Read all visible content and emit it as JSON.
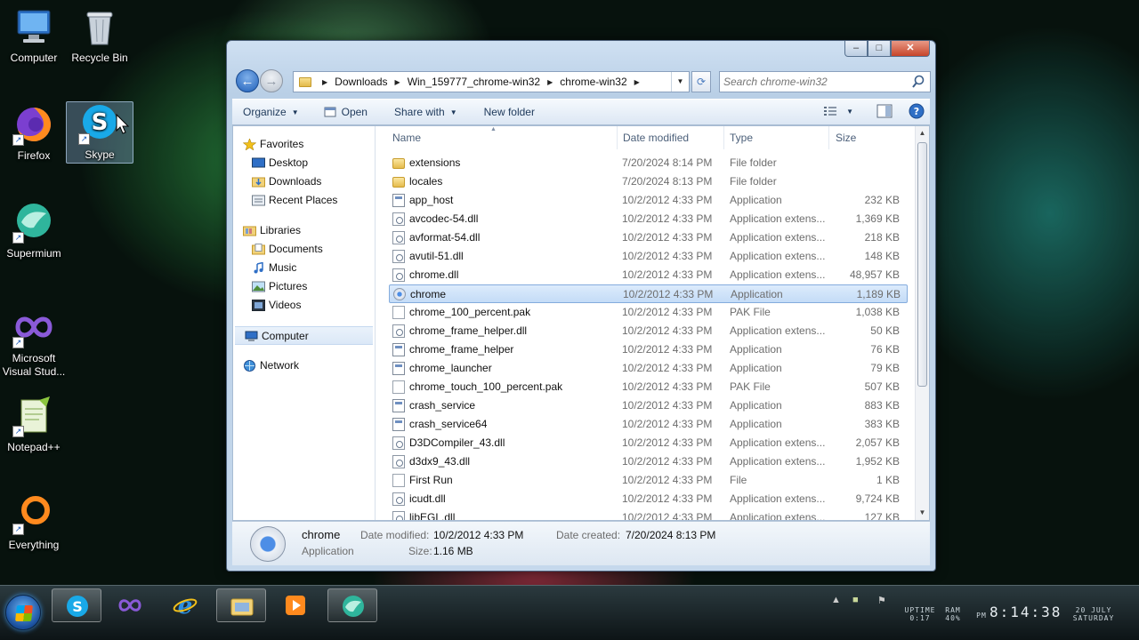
{
  "desktop": {
    "icons": [
      {
        "label": "Computer"
      },
      {
        "label": "Recycle Bin"
      },
      {
        "label": "Firefox"
      },
      {
        "label": "Skype"
      },
      {
        "label": "Supermium"
      },
      {
        "label": "Microsoft Visual Stud..."
      },
      {
        "label": "Notepad++"
      },
      {
        "label": "Everything"
      }
    ],
    "selected_icon": "Skype"
  },
  "window": {
    "caption_buttons": {
      "minimize": "–",
      "maximize": "□",
      "close": "✕"
    },
    "breadcrumb": [
      "Downloads",
      "Win_159777_chrome-win32",
      "chrome-win32"
    ],
    "search_placeholder": "Search chrome-win32",
    "toolbar": {
      "organize": "Organize",
      "open": "Open",
      "share_with": "Share with",
      "new_folder": "New folder"
    },
    "nav": {
      "favorites": "Favorites",
      "desktop": "Desktop",
      "downloads": "Downloads",
      "recent_places": "Recent Places",
      "libraries": "Libraries",
      "documents": "Documents",
      "music": "Music",
      "pictures": "Pictures",
      "videos": "Videos",
      "computer": "Computer",
      "network": "Network"
    },
    "columns": {
      "name": "Name",
      "date": "Date modified",
      "type": "Type",
      "size": "Size"
    },
    "files": [
      {
        "name": "extensions",
        "date": "7/20/2024 8:14 PM",
        "type": "File folder",
        "size": "",
        "icon": "folder-icon"
      },
      {
        "name": "locales",
        "date": "7/20/2024 8:13 PM",
        "type": "File folder",
        "size": "",
        "icon": "folder-icon"
      },
      {
        "name": "app_host",
        "date": "10/2/2012 4:33 PM",
        "type": "Application",
        "size": "232 KB",
        "icon": "application-icon"
      },
      {
        "name": "avcodec-54.dll",
        "date": "10/2/2012 4:33 PM",
        "type": "Application extens...",
        "size": "1,369 KB",
        "icon": "dll-icon"
      },
      {
        "name": "avformat-54.dll",
        "date": "10/2/2012 4:33 PM",
        "type": "Application extens...",
        "size": "218 KB",
        "icon": "dll-icon"
      },
      {
        "name": "avutil-51.dll",
        "date": "10/2/2012 4:33 PM",
        "type": "Application extens...",
        "size": "148 KB",
        "icon": "dll-icon"
      },
      {
        "name": "chrome.dll",
        "date": "10/2/2012 4:33 PM",
        "type": "Application extens...",
        "size": "48,957 KB",
        "icon": "dll-icon"
      },
      {
        "name": "chrome",
        "date": "10/2/2012 4:33 PM",
        "type": "Application",
        "size": "1,189 KB",
        "icon": "chrome-icon",
        "selected": true
      },
      {
        "name": "chrome_100_percent.pak",
        "date": "10/2/2012 4:33 PM",
        "type": "PAK File",
        "size": "1,038 KB",
        "icon": "document-icon"
      },
      {
        "name": "chrome_frame_helper.dll",
        "date": "10/2/2012 4:33 PM",
        "type": "Application extens...",
        "size": "50 KB",
        "icon": "dll-icon"
      },
      {
        "name": "chrome_frame_helper",
        "date": "10/2/2012 4:33 PM",
        "type": "Application",
        "size": "76 KB",
        "icon": "application-icon"
      },
      {
        "name": "chrome_launcher",
        "date": "10/2/2012 4:33 PM",
        "type": "Application",
        "size": "79 KB",
        "icon": "application-icon"
      },
      {
        "name": "chrome_touch_100_percent.pak",
        "date": "10/2/2012 4:33 PM",
        "type": "PAK File",
        "size": "507 KB",
        "icon": "document-icon"
      },
      {
        "name": "crash_service",
        "date": "10/2/2012 4:33 PM",
        "type": "Application",
        "size": "883 KB",
        "icon": "application-icon"
      },
      {
        "name": "crash_service64",
        "date": "10/2/2012 4:33 PM",
        "type": "Application",
        "size": "383 KB",
        "icon": "application-icon"
      },
      {
        "name": "D3DCompiler_43.dll",
        "date": "10/2/2012 4:33 PM",
        "type": "Application extens...",
        "size": "2,057 KB",
        "icon": "dll-icon"
      },
      {
        "name": "d3dx9_43.dll",
        "date": "10/2/2012 4:33 PM",
        "type": "Application extens...",
        "size": "1,952 KB",
        "icon": "dll-icon"
      },
      {
        "name": "First Run",
        "date": "10/2/2012 4:33 PM",
        "type": "File",
        "size": "1 KB",
        "icon": "document-icon"
      },
      {
        "name": "icudt.dll",
        "date": "10/2/2012 4:33 PM",
        "type": "Application extens...",
        "size": "9,724 KB",
        "icon": "dll-icon"
      },
      {
        "name": "libEGL.dll",
        "date": "10/2/2012 4:33 PM",
        "type": "Application extens...",
        "size": "127 KB",
        "icon": "dll-icon"
      }
    ],
    "details": {
      "name": "chrome",
      "type": "Application",
      "date_modified_label": "Date modified:",
      "date_modified": "10/2/2012 4:33 PM",
      "date_created_label": "Date created:",
      "date_created": "7/20/2024 8:13 PM",
      "size_label": "Size:",
      "size": "1.16 MB"
    }
  },
  "taskbar": {
    "apps": [
      "Skype",
      "Microsoft Visual Studio",
      "Internet Explorer",
      "Windows Explorer",
      "Media Player",
      "Supermium"
    ],
    "tray": {
      "uptime_label": "UPTIME",
      "uptime": "0:17",
      "ram_label": "RAM",
      "ram": "40%",
      "meridiem": "PM",
      "time": "8:14:38",
      "date": "20 JULY",
      "weekday": "SATURDAY"
    }
  }
}
